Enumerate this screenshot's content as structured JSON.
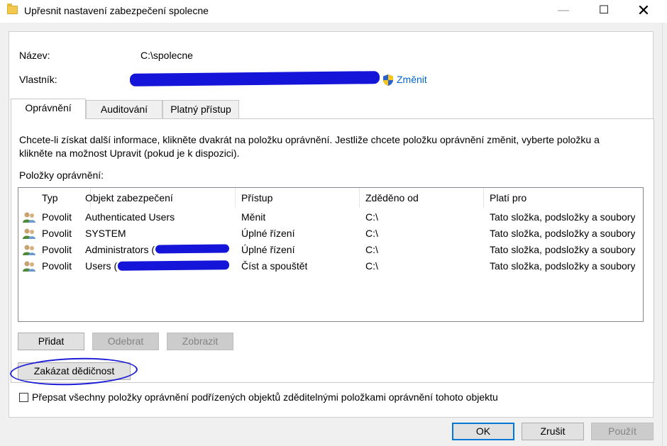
{
  "window": {
    "title": "Upřesnit nastavení zabezpečení spolecne",
    "minimize_glyph": "—",
    "maximize_glyph": "☐",
    "close_glyph": "✕"
  },
  "info": {
    "name_label": "Název:",
    "name_value": "C:\\spolecne",
    "owner_label": "Vlastník:",
    "change_link": "Změnit"
  },
  "tabs": [
    {
      "label": "Oprávnění",
      "active": true
    },
    {
      "label": "Auditování",
      "active": false
    },
    {
      "label": "Platný přístup",
      "active": false
    }
  ],
  "description": "Chcete-li získat další informace, klikněte dvakrát na položku oprávnění. Jestliže chcete položku oprávnění změnit, vyberte položku a klikněte na možnost Upravit (pokud je k dispozici).",
  "entries_label": "Položky oprávnění:",
  "table": {
    "columns": [
      "Typ",
      "Objekt zabezpečení",
      "Přístup",
      "Zděděno od",
      "Platí pro"
    ],
    "rows": [
      {
        "type": "Povolit",
        "principal": "Authenticated Users",
        "access": "Měnit",
        "inherited": "C:\\",
        "applies": "Tato složka, podsložky a soubory"
      },
      {
        "type": "Povolit",
        "principal": "SYSTEM",
        "access": "Úplné řízení",
        "inherited": "C:\\",
        "applies": "Tato složka, podsložky a soubory"
      },
      {
        "type": "Povolit",
        "principal": "Administrators (",
        "access": "Úplné řízení",
        "inherited": "C:\\",
        "applies": "Tato složka, podsložky a soubory"
      },
      {
        "type": "Povolit",
        "principal": "Users (",
        "access": "Číst a spouštět",
        "inherited": "C:\\",
        "applies": "Tato složka, podsložky a soubory"
      }
    ]
  },
  "buttons": {
    "add": "Přidat",
    "remove": "Odebrat",
    "view": "Zobrazit",
    "disable_inheritance": "Zakázat dědičnost",
    "ok": "OK",
    "cancel": "Zrušit",
    "apply": "Použít"
  },
  "replace_checkbox_label": "Přepsat všechny položky oprávnění podřízených objektů zděditelnými položkami oprávnění tohoto objektu",
  "colors": {
    "accent": "#0078d7",
    "link": "#0066cc",
    "redaction": "#1515d9",
    "dialog_bg": "#f0f0f0"
  },
  "icons": {
    "title": "folder-icon",
    "owner": "uac-shield-icon",
    "rows": "users-group-icon"
  }
}
